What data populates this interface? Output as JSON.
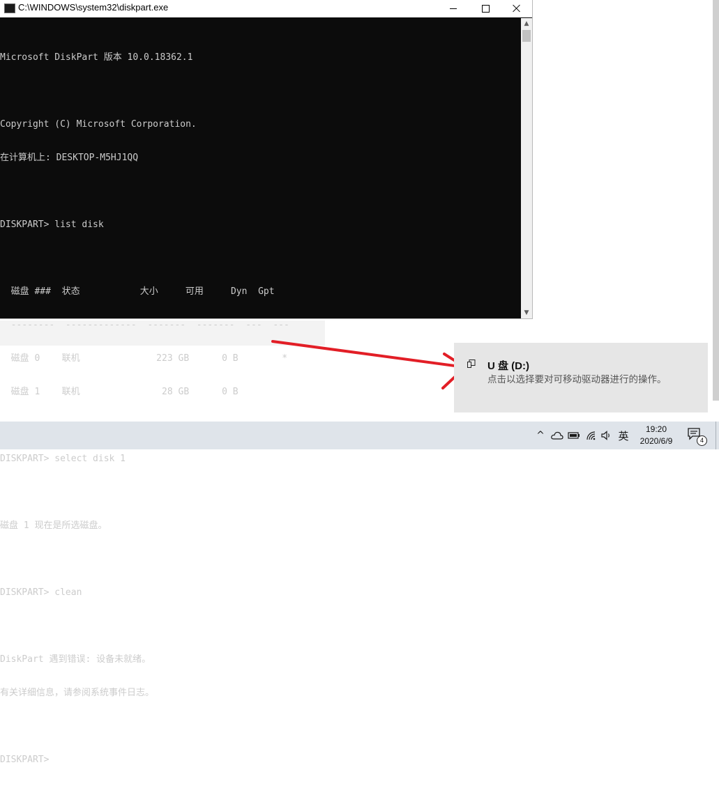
{
  "window": {
    "title": "C:\\WINDOWS\\system32\\diskpart.exe"
  },
  "console": {
    "lines": [
      "Microsoft DiskPart 版本 10.0.18362.1",
      "",
      "Copyright (C) Microsoft Corporation.",
      "在计算机上: DESKTOP-M5HJ1QQ",
      "",
      "DISKPART> list disk",
      "",
      "  磁盘 ###  状态           大小     可用     Dyn  Gpt",
      "  --------  -------------  -------  -------  ---  ---",
      "  磁盘 0    联机              223 GB      0 B        *",
      "  磁盘 1    联机               28 GB      0 B",
      "",
      "DISKPART> select disk 1",
      "",
      "磁盘 1 现在是所选磁盘。",
      "",
      "DISKPART> clean",
      "",
      "DiskPart 遇到错误: 设备未就绪。",
      "有关详细信息，请参阅系统事件日志。",
      "",
      "DISKPART>"
    ]
  },
  "toast": {
    "title": "U 盘 (D:)",
    "body": "点击以选择要对可移动驱动器进行的操作。"
  },
  "taskbar": {
    "chevron": "^",
    "ime": "英",
    "time": "19:20",
    "date": "2020/6/9",
    "notification_count": "4"
  },
  "colors": {
    "console_bg": "#0c0c0c",
    "console_text": "#cccccc",
    "arrow": "#e21e26",
    "taskbar_bg": "#dfe4ea",
    "toast_bg": "#e6e6e6"
  },
  "icons": {
    "app": "console-icon",
    "toast": "usb-drive-icon",
    "tray": [
      "chevron-up-icon",
      "onedrive-icon",
      "battery-icon",
      "network-icon",
      "volume-icon",
      "action-center-icon"
    ]
  }
}
